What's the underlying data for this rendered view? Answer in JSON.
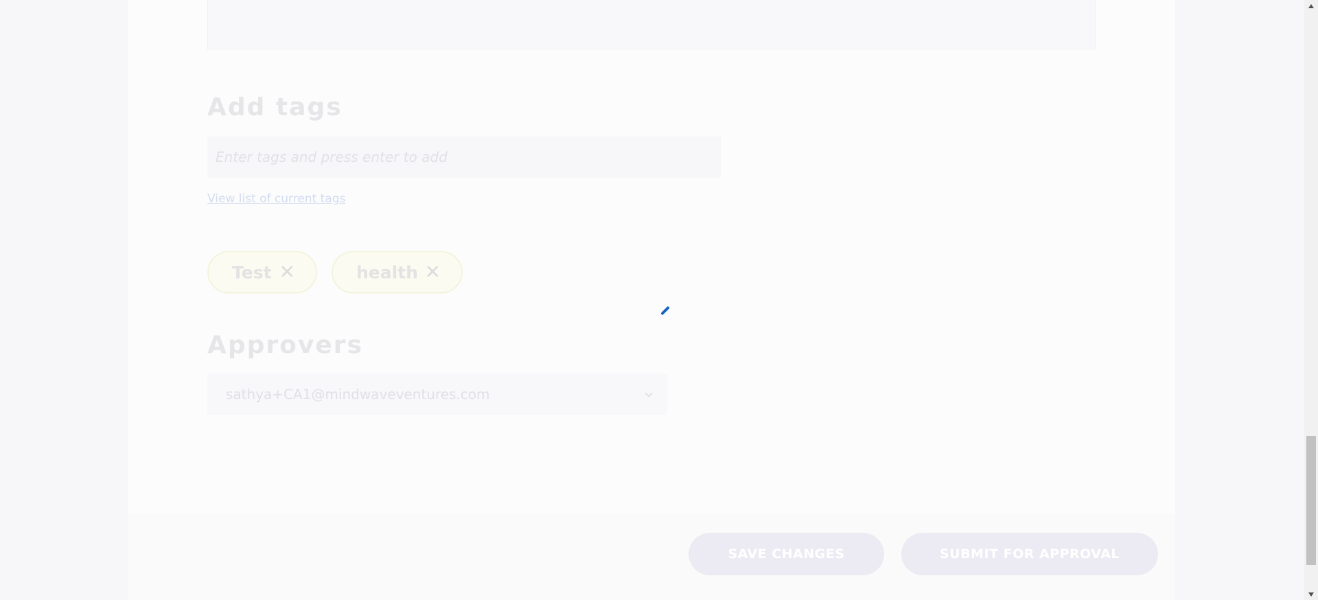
{
  "tags_section": {
    "title": "Add tags",
    "input_placeholder": "Enter tags and press enter to add",
    "view_link": "View list of current tags",
    "tags": [
      {
        "label": "Test"
      },
      {
        "label": "health"
      }
    ],
    "remove_glyph": "✕"
  },
  "approvers_section": {
    "title": "Approvers",
    "selected": "sathya+CA1@mindwaveventures.com"
  },
  "actions": {
    "save_label": "SAVE CHANGES",
    "submit_label": "SUBMIT FOR APPROVAL"
  },
  "icons": {
    "spinner": "loading-spinner-icon",
    "chevron": "chevron-down-icon",
    "remove": "close-icon"
  },
  "colors": {
    "spinner": "#1565c0",
    "button_bg": "#ecebf3",
    "chip_border": "#f3f4dc"
  }
}
